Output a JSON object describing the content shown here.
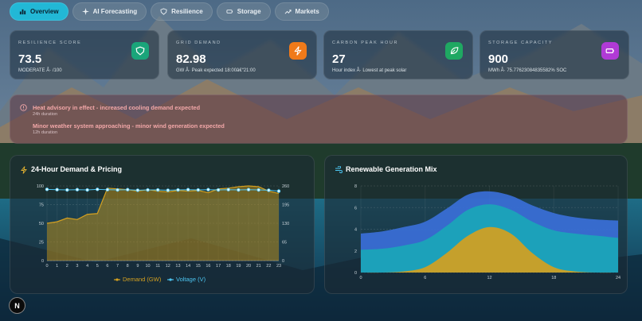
{
  "nav": {
    "tabs": [
      {
        "label": "Overview",
        "icon": "bar-chart-icon",
        "active": true
      },
      {
        "label": "AI Forecasting",
        "icon": "sparkle-icon",
        "active": false
      },
      {
        "label": "Resilience",
        "icon": "shield-icon",
        "active": false
      },
      {
        "label": "Storage",
        "icon": "battery-icon",
        "active": false
      },
      {
        "label": "Markets",
        "icon": "trend-up-icon",
        "active": false
      }
    ]
  },
  "kpis": [
    {
      "label": "RESILIENCE SCORE",
      "value": "73.5",
      "sub": "MODERATE Â· /100",
      "icon": "shield-icon",
      "color": "#1aa57a"
    },
    {
      "label": "GRID DEMAND",
      "value": "82.98",
      "sub": "GW Â· Peak expected 18:00â€“21:00",
      "icon": "bolt-icon",
      "color": "#f07a1a"
    },
    {
      "label": "CARBON PEAK HOUR",
      "value": "27",
      "sub": "Hour index Â· Lowest at peak solar",
      "icon": "leaf-icon",
      "color": "#1fa862"
    },
    {
      "label": "STORAGE CAPACITY",
      "value": "900",
      "sub": "MWh Â· 75.77623084835582% SOC",
      "icon": "battery-icon",
      "color": "#b03ad6"
    }
  ],
  "alerts": [
    {
      "title": "Heat advisory in effect - increased cooling demand expected",
      "duration": "24h duration"
    },
    {
      "title": "Minor weather system approaching - minor wind generation expected",
      "duration": "12h duration"
    }
  ],
  "logo_letter": "N",
  "chart_data": [
    {
      "type": "area",
      "title": "24-Hour Demand & Pricing",
      "x": [
        0,
        1,
        2,
        3,
        4,
        5,
        6,
        7,
        8,
        9,
        10,
        11,
        12,
        13,
        14,
        15,
        16,
        17,
        18,
        19,
        20,
        21,
        22,
        23
      ],
      "xticks": [
        "0",
        "1",
        "2",
        "3",
        "4",
        "5",
        "6",
        "7",
        "8",
        "9",
        "10",
        "11",
        "12",
        "13",
        "14",
        "15",
        "16",
        "17",
        "18",
        "19",
        "20",
        "21",
        "22",
        "23"
      ],
      "ylim": [
        0,
        100
      ],
      "yticks": [
        "0",
        "25",
        "50",
        "75",
        "100"
      ],
      "y2lim": [
        0,
        260
      ],
      "y2ticks": [
        "0",
        "65",
        "130",
        "195",
        "260"
      ],
      "grid": true,
      "legend_position": "bottom",
      "series": [
        {
          "name": "Demand (GW)",
          "axis": "left",
          "color": "#d4a020",
          "values": [
            50,
            52,
            57,
            55,
            62,
            63,
            97,
            96,
            95,
            93,
            95,
            93,
            92,
            94,
            93,
            94,
            91,
            96,
            97,
            99,
            100,
            99,
            93,
            90
          ]
        },
        {
          "name": "Voltage (V)",
          "axis": "right",
          "color": "#4cc4f0",
          "values": [
            248,
            247,
            246,
            247,
            246,
            248,
            247,
            246,
            247,
            245,
            246,
            246,
            245,
            246,
            247,
            246,
            247,
            246,
            247,
            246,
            247,
            246,
            245,
            242
          ]
        }
      ]
    },
    {
      "type": "area",
      "title": "Renewable Generation Mix",
      "x": [
        0,
        2,
        4,
        6,
        8,
        10,
        12,
        14,
        16,
        18,
        20,
        22,
        24
      ],
      "xticks": [
        "0",
        "6",
        "12",
        "18",
        "24"
      ],
      "ylim": [
        0,
        8
      ],
      "yticks": [
        "0",
        "2",
        "4",
        "6",
        "8"
      ],
      "grid": true,
      "stacked": true,
      "series": [
        {
          "color": "#d4a020",
          "values": [
            0,
            0,
            0.1,
            0.5,
            1.8,
            3.4,
            4.2,
            3.6,
            1.8,
            0.5,
            0.1,
            0,
            0
          ]
        },
        {
          "color": "#1aa6b8",
          "values": [
            2.1,
            2.2,
            2.4,
            2.5,
            2.5,
            2.4,
            2.1,
            2.2,
            2.9,
            3.4,
            3.5,
            3.4,
            3.2
          ]
        },
        {
          "color": "#3a6fd8",
          "values": [
            1.5,
            1.6,
            1.7,
            1.7,
            1.6,
            1.4,
            1.2,
            1.3,
            1.5,
            1.6,
            1.5,
            1.5,
            1.6
          ]
        }
      ]
    }
  ]
}
